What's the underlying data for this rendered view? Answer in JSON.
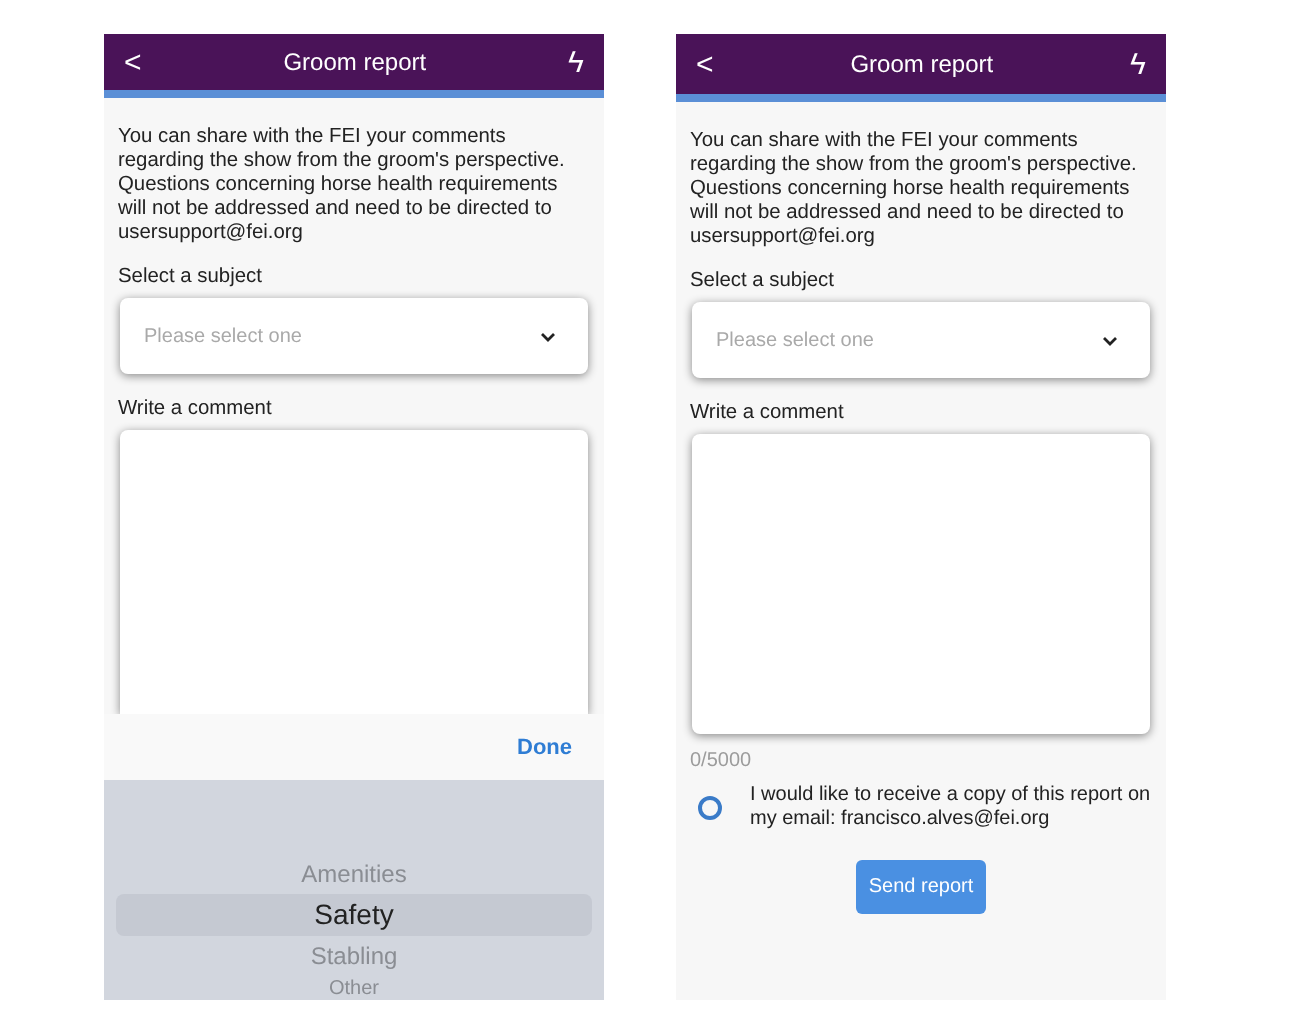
{
  "screens": [
    {
      "header": {
        "back": "<",
        "title": "Groom report",
        "action": "ϟ"
      },
      "intro": "You can share with the FEI your comments regarding the show from the groom's perspective. Questions concerning horse health requirements will not be addressed and need to be directed to usersupport@fei.org",
      "subject_label": "Select a subject",
      "subject_field": {
        "placeholder": "Please select one"
      },
      "comment_label": "Write a comment",
      "picker": {
        "done": "Done",
        "items": [
          {
            "label": "Amenities",
            "selected": false
          },
          {
            "label": "Safety",
            "selected": true
          },
          {
            "label": "Stabling",
            "selected": false
          },
          {
            "label": "Other",
            "selected": false
          }
        ]
      }
    },
    {
      "header": {
        "back": "<",
        "title": "Groom report",
        "action": "ϟ"
      },
      "intro": "You can share with the FEI your comments regarding the show from the groom's perspective. Questions concerning horse health requirements will not be addressed and need to be directed to usersupport@fei.org",
      "subject_label": "Select a subject",
      "subject_field": {
        "placeholder": "Please select one"
      },
      "comment_label": "Write a comment",
      "counter": "0/5000",
      "copy_option": {
        "label": "I would like to receive a copy of this report on my email: francisco.alves@fei.org",
        "checked": false
      },
      "button": "Send report"
    }
  ]
}
